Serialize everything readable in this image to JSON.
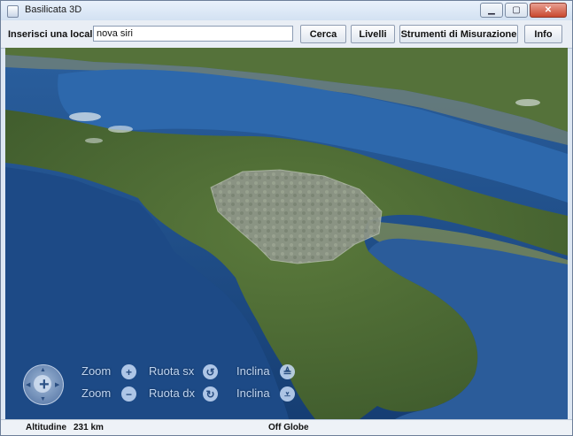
{
  "window": {
    "title": "Basilicata 3D",
    "buttons": [
      "minimize",
      "maximize",
      "close"
    ]
  },
  "toolbar": {
    "location_label": "Inserisci una località",
    "search_value": "nova siri",
    "search_button": "Cerca",
    "layers_button": "Livelli",
    "measure_button": "Strumenti di Misurazione",
    "info_button": "Info"
  },
  "map": {
    "controls": {
      "zoom_in": "Zoom",
      "zoom_out": "Zoom",
      "rotate_left": "Ruota sx",
      "rotate_right": "Ruota dx",
      "tilt_up": "Inclina",
      "tilt_down": "Inclina"
    },
    "icons": [
      "pan-compass-icon",
      "zoom-in-icon",
      "zoom-out-icon",
      "rotate-left-icon",
      "rotate-right-icon",
      "tilt-up-icon",
      "tilt-down-icon"
    ]
  },
  "status": {
    "altitude_label": "Altitudine",
    "altitude_value": "231 km",
    "globe_status": "Off Globe"
  }
}
